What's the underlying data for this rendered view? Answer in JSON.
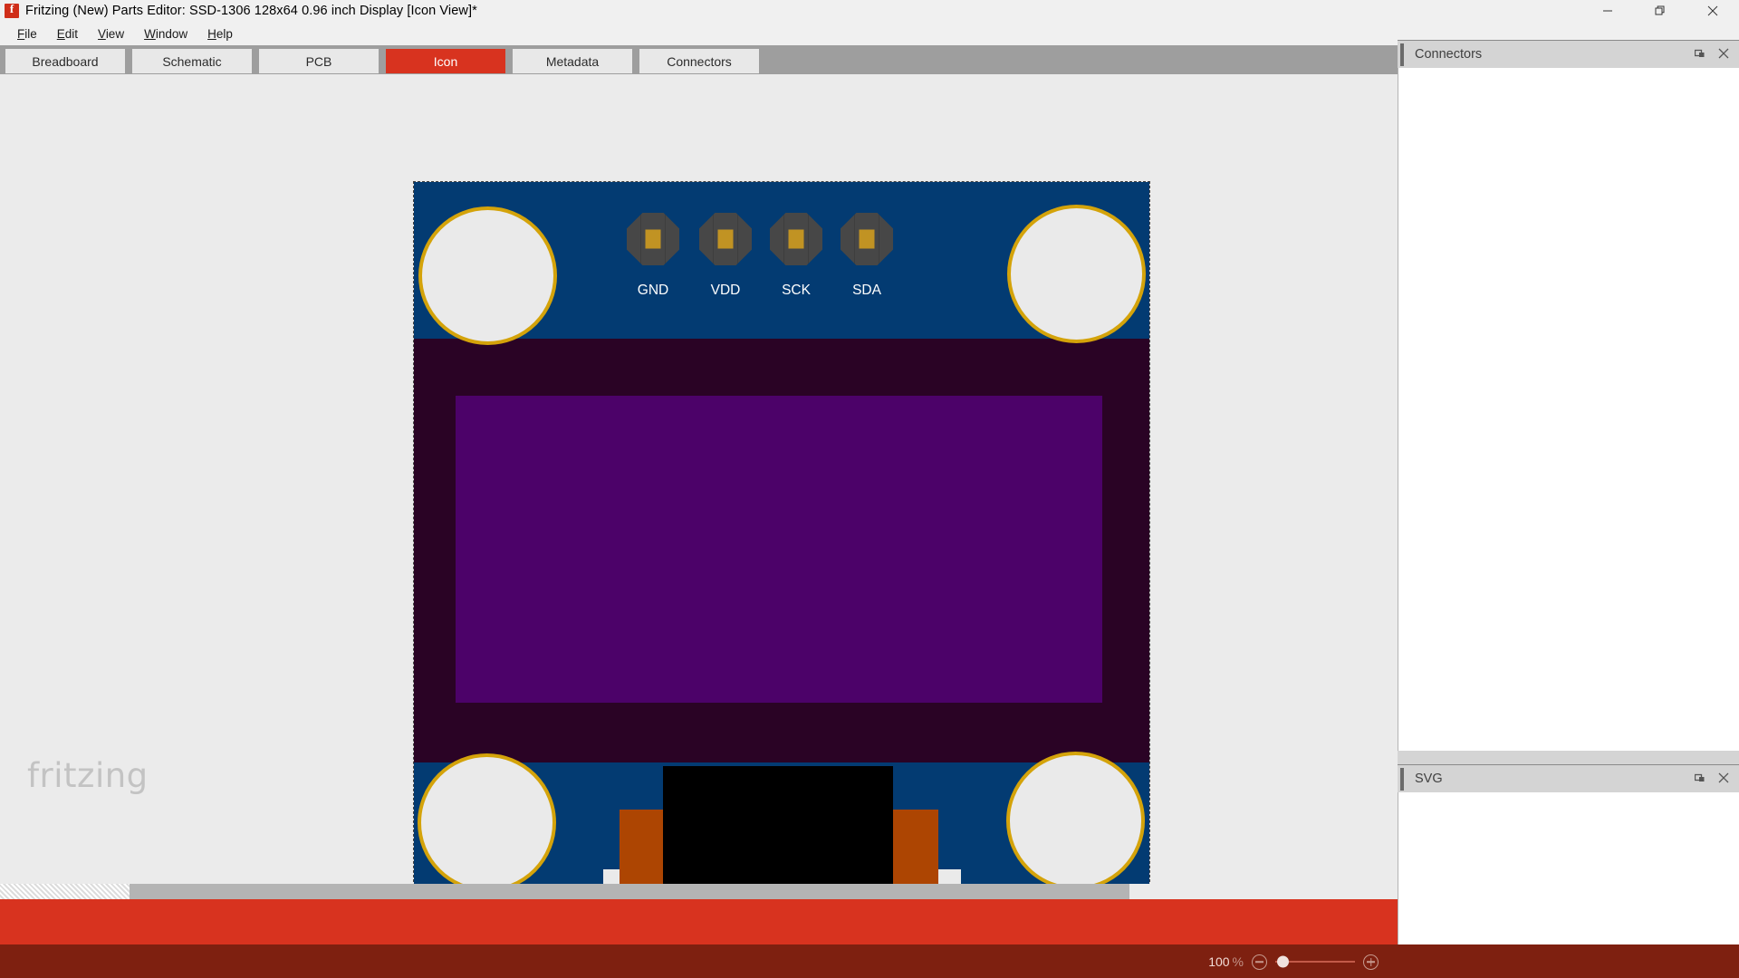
{
  "window": {
    "title": "Fritzing (New) Parts Editor: SSD-1306 128x64 0.96 inch  Display [Icon View]*",
    "app_icon": "fritzing-icon",
    "controls": {
      "minimize": "minimize-icon",
      "restore": "restore-icon",
      "close": "close-icon"
    }
  },
  "menubar": {
    "items": [
      {
        "label": "File",
        "accel": "F"
      },
      {
        "label": "Edit",
        "accel": "E"
      },
      {
        "label": "View",
        "accel": "V"
      },
      {
        "label": "Window",
        "accel": "W"
      },
      {
        "label": "Help",
        "accel": "H"
      }
    ]
  },
  "tabs": {
    "active": "Icon",
    "items": [
      {
        "label": "Breadboard",
        "active": false
      },
      {
        "label": "Schematic",
        "active": false
      },
      {
        "label": "PCB",
        "active": false
      },
      {
        "label": "Icon",
        "active": true
      },
      {
        "label": "Metadata",
        "active": false
      },
      {
        "label": "Connectors",
        "active": false
      }
    ]
  },
  "canvas": {
    "watermark": "fritzing",
    "part": {
      "name": "SSD-1306 128x64 0.96 inch Display",
      "selected": true,
      "board_color": "#033b72",
      "display_frame_color": "#2a0325",
      "display_screen_color": "#4c0269",
      "hole_ring_color": "#d4a30a",
      "hole_fill_color": "#eaeaea",
      "pad_color": "#474747",
      "pad_center_color": "#c19323",
      "connector_body_color": "#000000",
      "connector_accent_color": "#ad4502",
      "pins": [
        {
          "label": "GND"
        },
        {
          "label": "VDD"
        },
        {
          "label": "SCK"
        },
        {
          "label": "SDA"
        }
      ]
    }
  },
  "zoom": {
    "value": "100",
    "unit": "%",
    "minus_icon": "zoom-out-icon",
    "plus_icon": "zoom-in-icon",
    "slider_position_pct": 2
  },
  "dock": {
    "panels": [
      {
        "title": "Connectors",
        "float_icon": "float-icon",
        "close_icon": "close-icon",
        "content": ""
      },
      {
        "title": "SVG",
        "float_icon": "float-icon",
        "close_icon": "close-icon",
        "content": ""
      }
    ]
  },
  "colors": {
    "accent_red": "#d8331f",
    "dark_red": "#7e2010",
    "tab_bar_gray": "#9e9e9e",
    "canvas_gray": "#ebebeb",
    "dock_gray": "#d4d4d4"
  }
}
